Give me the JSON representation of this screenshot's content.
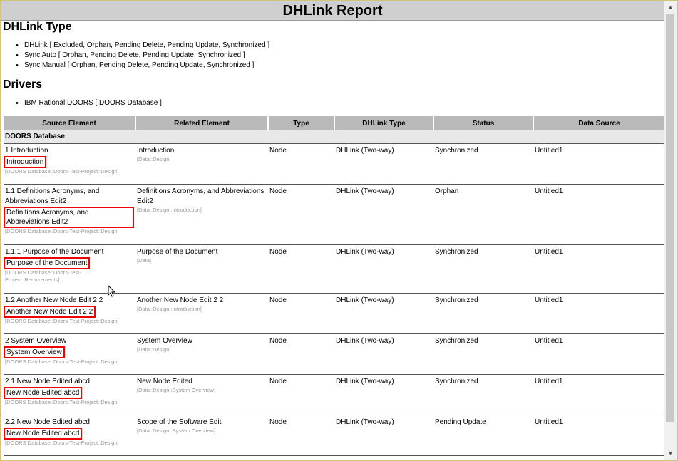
{
  "report": {
    "title": "DHLink Report"
  },
  "dhlink_type": {
    "heading": "DHLink Type",
    "items": [
      "DHLink [ Excluded, Orphan, Pending Delete, Pending Update, Synchronized ]",
      "Sync Auto [ Orphan, Pending Delete, Pending Update, Synchronized ]",
      "Sync Manual [ Orphan, Pending Delete, Pending Update, Synchronized ]"
    ]
  },
  "drivers": {
    "heading": "Drivers",
    "items": [
      "IBM Rational DOORS [ DOORS Database ]"
    ]
  },
  "table": {
    "headers": [
      "Source Element",
      "Related Element",
      "Type",
      "DHLink Type",
      "Status",
      "Data Source"
    ],
    "group": "DOORS Database",
    "rows": [
      {
        "src": "1 Introduction",
        "hl": "Introduction",
        "path": "[DOORS Database::Doors-Test-Project::Design]",
        "rel": "Introduction",
        "relpath": "[Data::Design]",
        "type": "Node",
        "dhtype": "DHLink (Two-way)",
        "status": "Synchronized",
        "ds": "Untitled1"
      },
      {
        "src": "1.1 Definitions Acronyms, and Abbreviations Edit2",
        "hl": "Definitions Acronyms, and Abbreviations Edit2",
        "path": "[DOORS Database::Doors-Test-Project::Design]",
        "rel": "Definitions Acronyms, and Abbreviations Edit2",
        "relpath": "[Data::Design::Introduction]",
        "type": "Node",
        "dhtype": "DHLink (Two-way)",
        "status": "Orphan",
        "ds": "Untitled1"
      },
      {
        "src": "1.1.1 Purpose of the Document",
        "hl": "Purpose of the Document",
        "path": "[DOORS Database::Doors-Test-Project::Requirements]",
        "rel": "Purpose of the Document",
        "relpath": "[Data]",
        "type": "Node",
        "dhtype": "DHLink (Two-way)",
        "status": "Synchronized",
        "ds": "Untitled1"
      },
      {
        "src": "1.2 Another New Node Edit 2 2",
        "hl": "Another New Node Edit 2 2",
        "path": "[DOORS Database::Doors-Test-Project::Design]",
        "rel": "Another New Node Edit 2 2",
        "relpath": "[Data::Design::Introduction]",
        "type": "Node",
        "dhtype": "DHLink (Two-way)",
        "status": "Synchronized",
        "ds": "Untitled1"
      },
      {
        "src": "2 System Overview",
        "hl": "System Overview",
        "path": "[DOORS Database::Doors-Test-Project::Design]",
        "rel": "System Overview",
        "relpath": "[Data::Design]",
        "type": "Node",
        "dhtype": "DHLink (Two-way)",
        "status": "Synchronized",
        "ds": "Untitled1"
      },
      {
        "src": "2.1 New Node Edited abcd",
        "hl": "New Node Edited abcd",
        "path": "[DOORS Database::Doors-Test-Project::Design]",
        "rel": "New Node Edited",
        "relpath": "[Data::Design::System Overview]",
        "type": "Node",
        "dhtype": "DHLink (Two-way)",
        "status": "Synchronized",
        "ds": "Untitled1"
      },
      {
        "src": "2.2 New Node Edited abcd",
        "hl": "New Node Edited abcd",
        "path": "[DOORS Database::Doors-Test-Project::Design]",
        "rel": "Scope of the Software Edit",
        "relpath": "[Data::Design::System Overview]",
        "type": "Node",
        "dhtype": "DHLink (Two-way)",
        "status": "Pending Update",
        "ds": "Untitled1"
      }
    ]
  }
}
